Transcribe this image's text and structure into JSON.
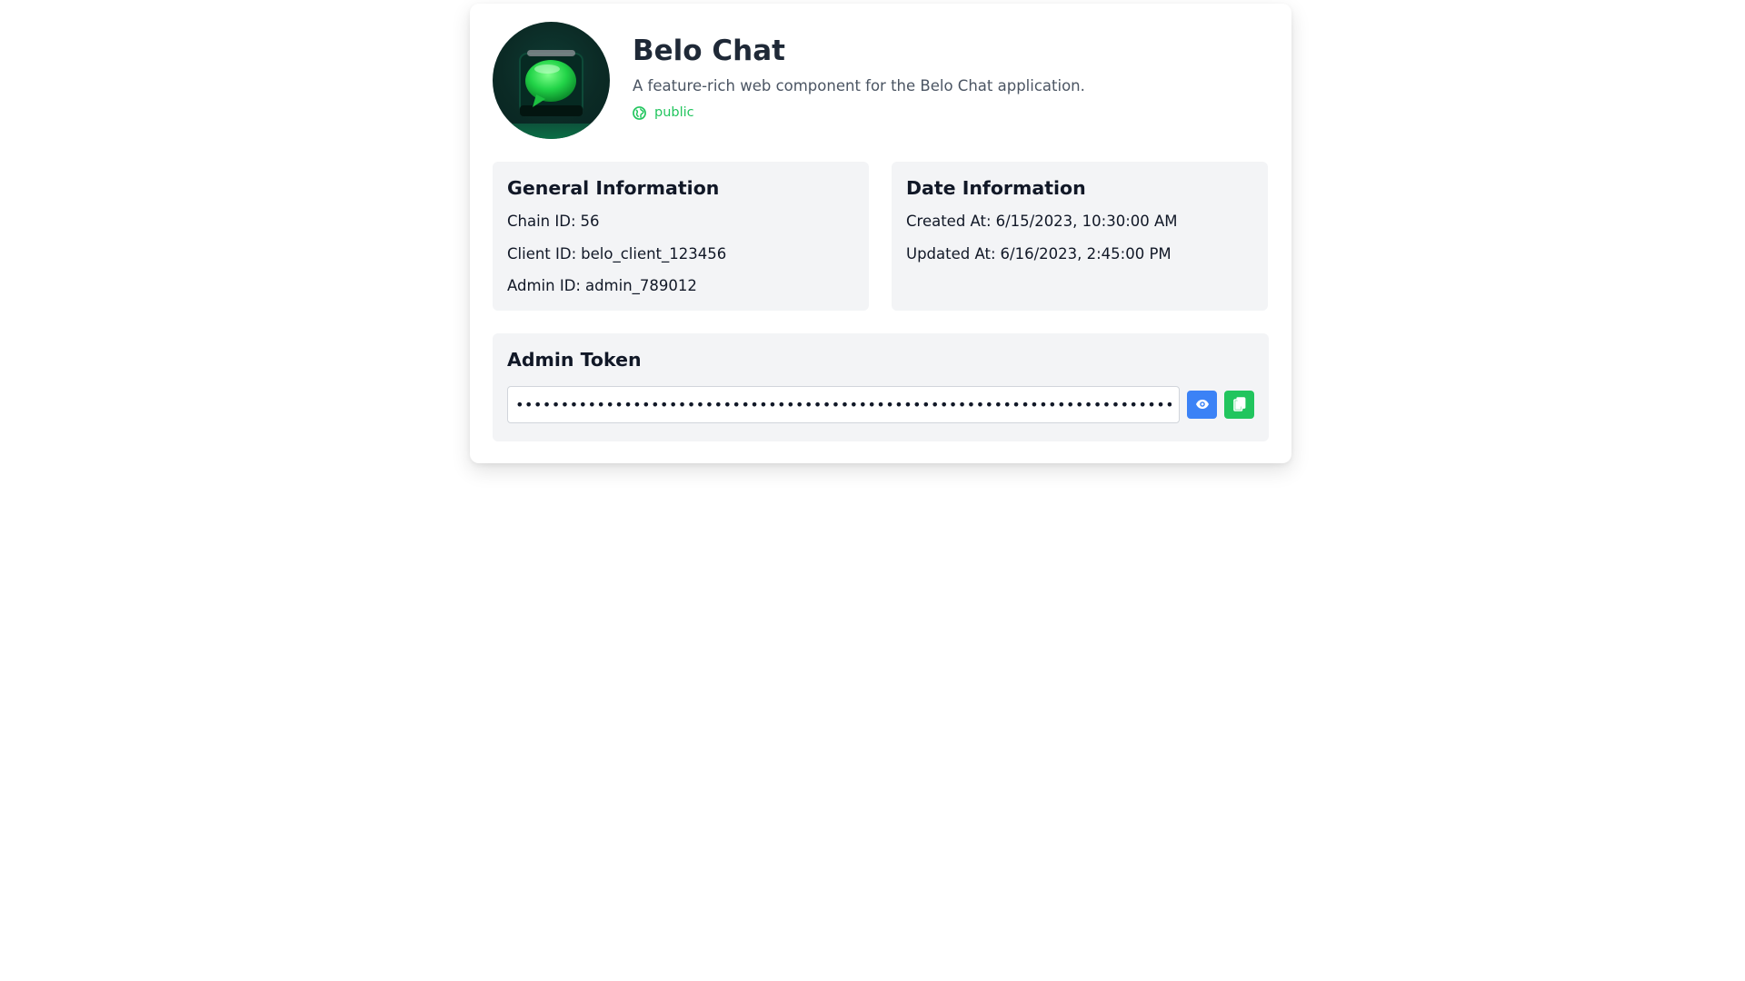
{
  "app": {
    "title": "Belo Chat",
    "description": "A feature-rich web component for the Belo Chat application.",
    "visibility": "public",
    "avatar_icon": "chat-bubble-icon"
  },
  "general_info": {
    "heading": "General Information",
    "rows": [
      {
        "label": "Chain ID:",
        "value": "56"
      },
      {
        "label": "Client ID:",
        "value": "belo_client_123456"
      },
      {
        "label": "Admin ID:",
        "value": "admin_789012"
      }
    ]
  },
  "date_info": {
    "heading": "Date Information",
    "rows": [
      {
        "label": "Created At:",
        "value": "6/15/2023, 10:30:00 AM"
      },
      {
        "label": "Updated At:",
        "value": "6/16/2023, 2:45:00 PM"
      }
    ]
  },
  "admin_token": {
    "heading": "Admin Token",
    "masked_value": "••••••••••••••••••••••••••••••••••••••••••••••••••••••••••••••••••••••••••••••••••••••••••",
    "show_icon": "eye-icon",
    "copy_icon": "copy-icon"
  },
  "colors": {
    "accent_blue": "#3b82f6",
    "accent_green": "#22c55e",
    "panel_bg": "#f3f4f6"
  }
}
